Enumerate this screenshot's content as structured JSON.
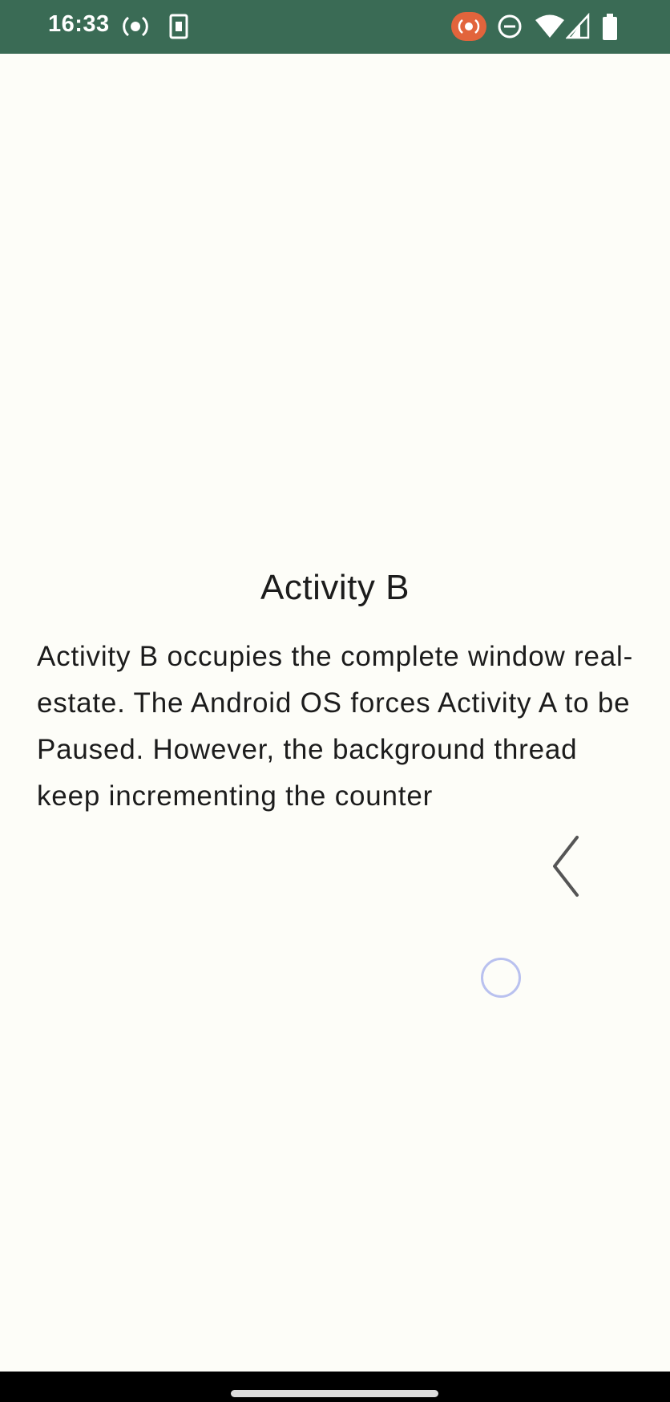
{
  "status_bar": {
    "time": "16:33",
    "background_color": "#3a6b55",
    "left_icons": [
      "screen-record-icon",
      "sim-card-icon"
    ],
    "right_icons": [
      "recording-indicator-icon",
      "do-not-disturb-icon",
      "wifi-icon",
      "cellular-signal-icon",
      "battery-icon"
    ]
  },
  "main": {
    "title": "Activity B",
    "description": "Activity B occupies the complete window real-estate. The Android OS forces Activity A to be Paused. However, the background thread keep incrementing the counter"
  },
  "colors": {
    "background": "#fdfdf8",
    "text": "#1c1c1c",
    "recording_accent": "#e2643c"
  }
}
